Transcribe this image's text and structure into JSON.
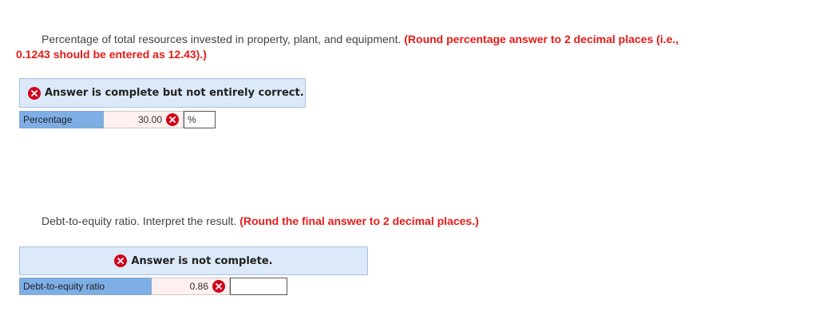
{
  "question1": {
    "prompt": "Percentage of total resources invested in property, plant, and equipment.",
    "instruction_line1": "(Round percentage answer to 2 decimal places (i.e.,",
    "instruction_line2": "0.1243 should be entered as 12.43).)",
    "banner_text": "Answer is complete but not entirely correct.",
    "row_label": "Percentage",
    "row_value": "30.00",
    "row_unit": "%"
  },
  "question2": {
    "prompt": "Debt-to-equity ratio. Interpret the result.",
    "instruction": "(Round the final answer to 2 decimal places.)",
    "banner_text": "Answer is not complete.",
    "row_label": "Debt-to-equity ratio",
    "row_value": "0.86",
    "row_unit": ""
  },
  "colors": {
    "error_red": "#d0021b",
    "instruction_red": "#e41b17",
    "banner_bg": "#dbe9f8",
    "label_bg": "#7daee6",
    "value_bg": "#fff0ef"
  },
  "icons": {
    "incorrect": "x-circle-icon"
  }
}
